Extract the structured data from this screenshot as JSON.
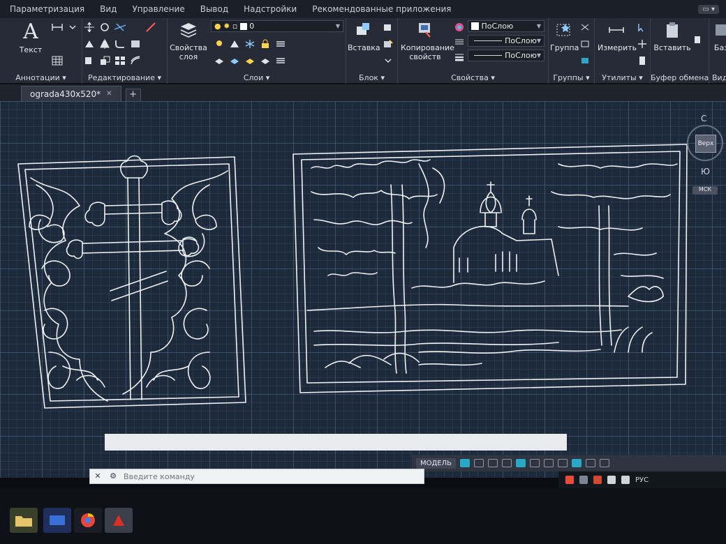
{
  "ribbon_tabs": [
    "Параметризация",
    "Вид",
    "Управление",
    "Вывод",
    "Надстройки",
    "Рекомендованные приложения"
  ],
  "ribbon": {
    "annotations": {
      "text_label": "Текст",
      "group_label": "Аннотации"
    },
    "edit": {
      "group_label": "Редактирование"
    },
    "layers": {
      "properties_label": "Свойства слоя",
      "group_label": "Слои",
      "current_layer": "0"
    },
    "block": {
      "insert_label": "Вставка",
      "group_label": "Блок"
    },
    "properties": {
      "match_label": "Копирование свойств",
      "group_label": "Свойства",
      "color": "ПоСлою",
      "linetype": "ПоСлою",
      "lineweight": "ПоСлою"
    },
    "groups": {
      "group_label": "Группа",
      "panel_label": "Группы"
    },
    "utilities": {
      "measure_label": "Измерить",
      "panel_label": "Утилиты"
    },
    "clipboard": {
      "paste_label": "Вставить",
      "panel_label": "Буфер обмена"
    },
    "view": {
      "base_label": "Баз",
      "panel_label": "Вид"
    }
  },
  "file_tabs": [
    {
      "name": "ograda430x520*"
    }
  ],
  "viewcube": {
    "north": "С",
    "south": "Ю",
    "face": "Верх",
    "wcs": "МСК"
  },
  "command_line": {
    "placeholder": "Введите команду"
  },
  "status_bar": {
    "model": "МОДЕЛЬ"
  },
  "tray": {
    "lang": "РУС"
  },
  "colors": {
    "canvas_bg": "#1d2a3c",
    "linework": "#eef2f6",
    "ribbon_bg": "#262b35",
    "accent": "#2aa7c9"
  }
}
